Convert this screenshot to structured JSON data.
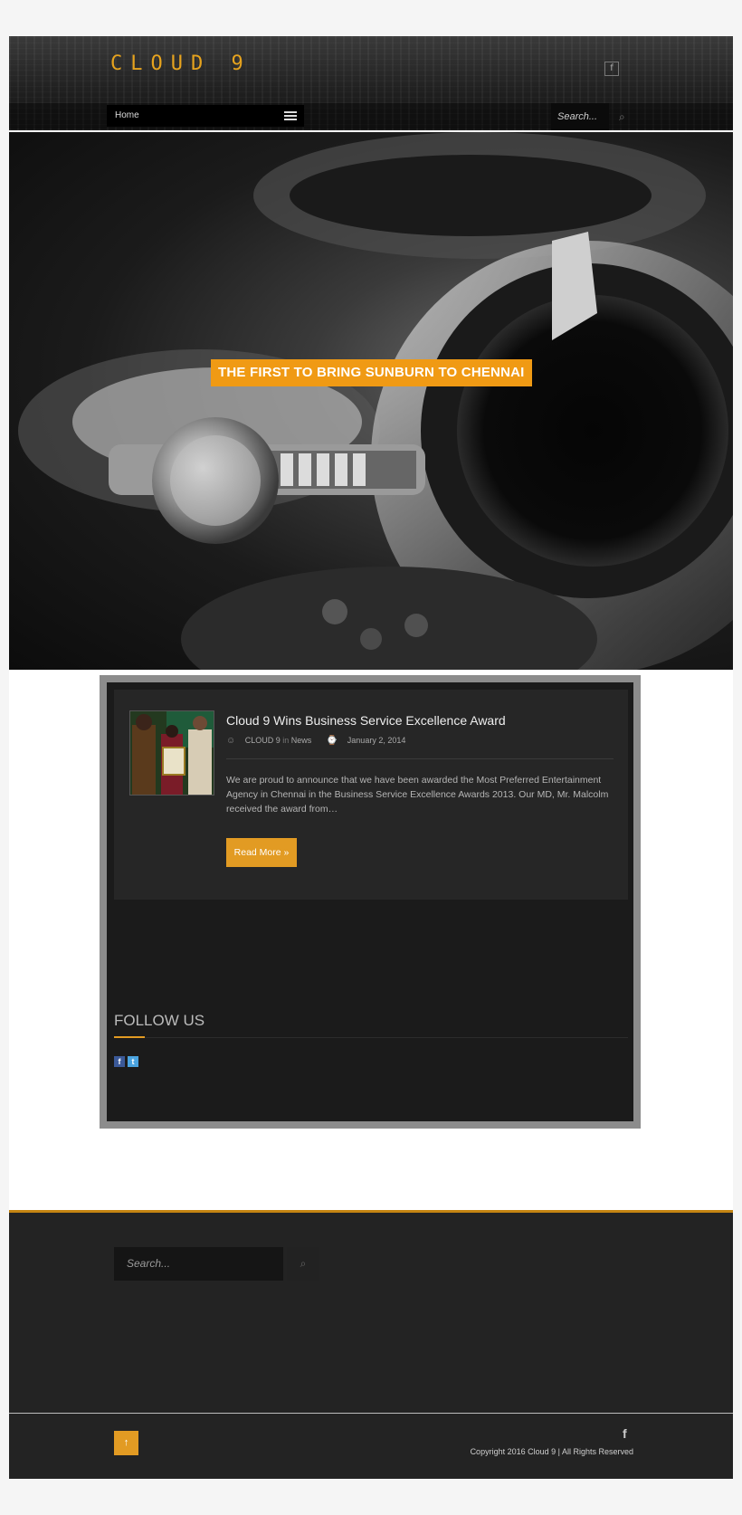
{
  "header": {
    "logo": "CLOUD 9",
    "facebook_icon": "f",
    "nav_home": "Home",
    "search_placeholder": "Search...",
    "search_icon": "⌕"
  },
  "hero": {
    "badge": "THE FIRST TO BRING SUNBURN TO CHENNAI"
  },
  "post": {
    "title": "Cloud 9 Wins Business Service Excellence Award",
    "author": "CLOUD 9",
    "in_label": "in",
    "category": "News",
    "date": "January 2, 2014",
    "excerpt": "We are proud to announce that we have been awarded the Most Preferred Entertainment Agency in Chennai in the Business Service Excellence Awards 2013.  Our MD, Mr. Malcolm received the award from…",
    "read_more": "Read More »"
  },
  "follow": {
    "title": "FOLLOW US",
    "facebook": "f",
    "twitter": "t"
  },
  "footer": {
    "search_placeholder": "Search...",
    "search_icon": "⌕",
    "to_top": "↑",
    "facebook_icon": "f",
    "copyright": "Copyright 2016 Cloud 9   |   All Rights Reserved"
  },
  "colors": {
    "accent": "#e29b23",
    "badge": "#f09a14",
    "dark_bg": "#1b1b1b",
    "post_bg": "#262626"
  }
}
